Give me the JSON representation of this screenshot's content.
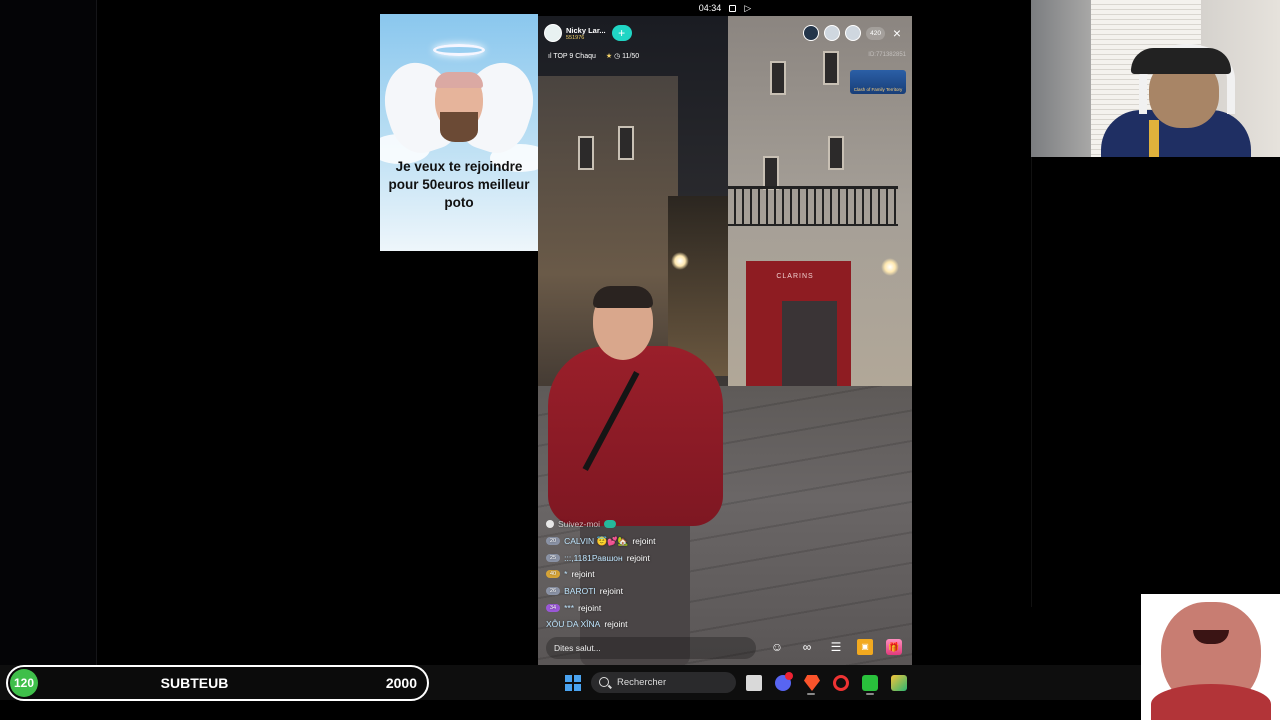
{
  "status_bar": {
    "time": "04:34"
  },
  "overlay": {
    "caption": "Je veux te rejoindre pour 50euros meilleur poto"
  },
  "stream": {
    "host_name": "Nicky Lar...",
    "host_likes": "551976",
    "follow_symbol": "+",
    "rank_label": "TOP 9 Chaqu",
    "task_progress": "11/50",
    "viewer_count": "420",
    "close_symbol": "×",
    "stream_id": "ID:771382851",
    "event_badge_label": "Clash of Family Territory",
    "comment_placeholder": "Dites salut...",
    "chat": [
      {
        "type": "follow",
        "text": "Suivez-moi"
      },
      {
        "level": "20",
        "level_color": "silver",
        "user": "CALVIN 😇💕🏡",
        "action": "rejoint"
      },
      {
        "level": "25",
        "level_color": "silver",
        "user": ":::,1181Равшон",
        "action": "rejoint"
      },
      {
        "level": "40",
        "level_color": "gold",
        "user": "*",
        "action": "rejoint"
      },
      {
        "level": "26",
        "level_color": "silver",
        "user": "BAROTI",
        "action": "rejoint"
      },
      {
        "level": "34",
        "level_color": "purple",
        "user": "***",
        "action": "rejoint"
      },
      {
        "level": "",
        "level_color": "",
        "user": "XÔU DA XÎNA",
        "action": "rejoint"
      }
    ],
    "tools": [
      "emoji-icon",
      "link-icon",
      "menu-icon",
      "treasure-box-icon",
      "gift-icon"
    ]
  },
  "sub_goal": {
    "current": "120",
    "label": "SUBTEUB",
    "target": "2000",
    "accent": "#3fbf4a"
  },
  "taskbar": {
    "search_placeholder": "Rechercher",
    "apps": [
      "files-icon",
      "discord-icon",
      "brave-icon",
      "opera-icon",
      "green-app-icon",
      "multicolor-app-icon"
    ]
  }
}
